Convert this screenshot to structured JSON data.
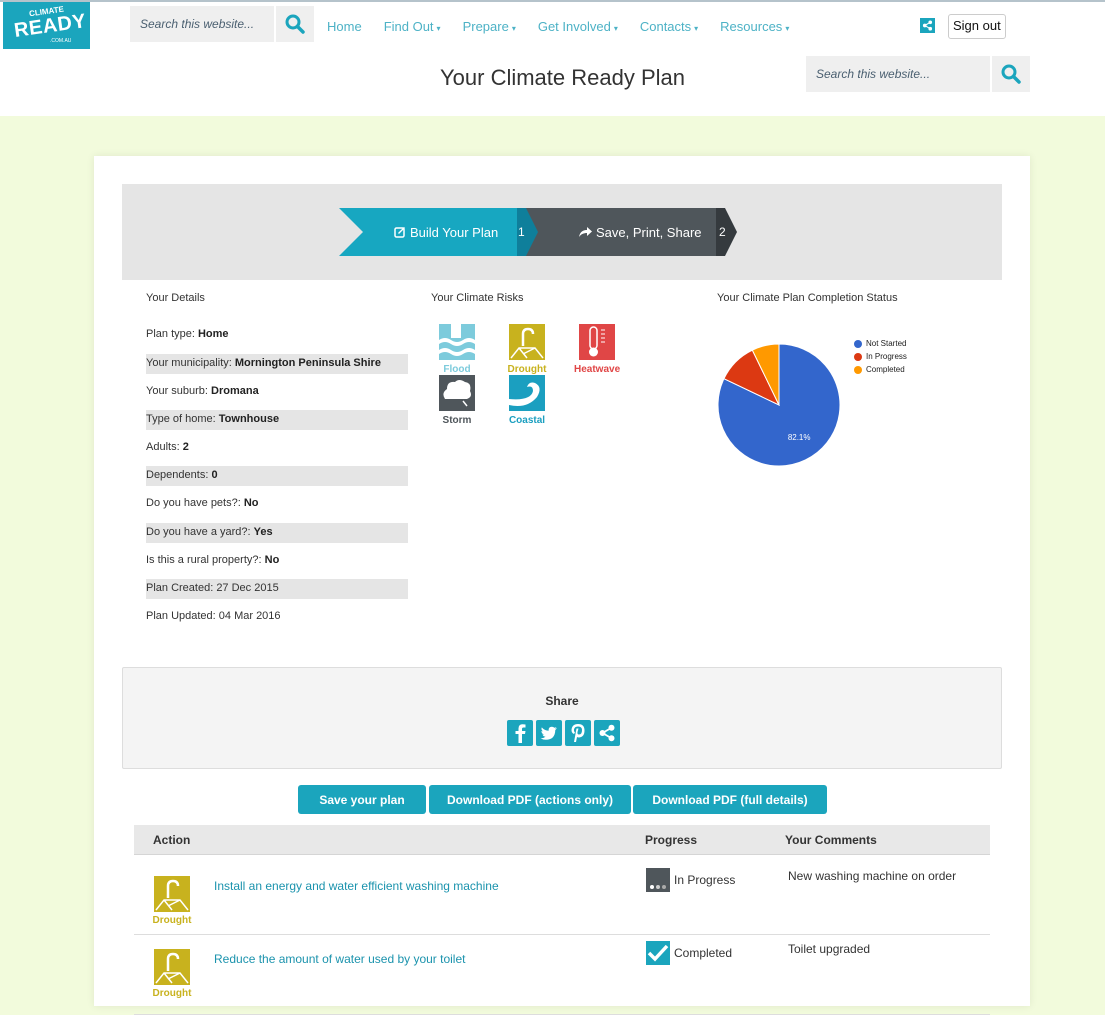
{
  "header": {
    "logo": {
      "line1": "CLIMATE",
      "line2": "READY",
      "line3": ".COM.AU"
    },
    "search_placeholder": "Search this website...",
    "nav": [
      {
        "label": "Home",
        "dropdown": false
      },
      {
        "label": "Find Out",
        "dropdown": true
      },
      {
        "label": "Prepare",
        "dropdown": true
      },
      {
        "label": "Get Involved",
        "dropdown": true
      },
      {
        "label": "Contacts",
        "dropdown": true
      },
      {
        "label": "Resources",
        "dropdown": true
      }
    ],
    "caret": "▾",
    "sign_out_label": "Sign out"
  },
  "title_bar": {
    "page_title": "Your Climate Ready Plan",
    "search_placeholder": "Search this website..."
  },
  "steps": [
    {
      "label": "Build Your Plan",
      "number": "1",
      "icon": "edit-icon",
      "active": true
    },
    {
      "label": "Save, Print, Share",
      "number": "2",
      "icon": "share-arrow-icon",
      "active": false
    }
  ],
  "details": {
    "heading": "Your Details",
    "rows": [
      {
        "label": "Plan type:",
        "value": "Home"
      },
      {
        "label": "Your municipality:",
        "value": "Mornington Peninsula Shire"
      },
      {
        "label": "Your suburb:",
        "value": "Dromana"
      },
      {
        "label": "Type of home:",
        "value": "Townhouse"
      },
      {
        "label": "Adults:",
        "value": "2"
      },
      {
        "label": "Dependents:",
        "value": "0"
      },
      {
        "label": "Do you have pets?:",
        "value": "No"
      },
      {
        "label": "Do you have a yard?:",
        "value": "Yes"
      },
      {
        "label": "Is this a rural property?:",
        "value": "No"
      },
      {
        "label": "Plan Created: 27 Dec 2015",
        "value": ""
      },
      {
        "label": "Plan Updated: 04 Mar 2016",
        "value": ""
      }
    ]
  },
  "risks": {
    "heading": "Your Climate Risks",
    "items": [
      {
        "label": "Flood",
        "color": "#7dcbdc"
      },
      {
        "label": "Drought",
        "color": "#c8b21e"
      },
      {
        "label": "Heatwave",
        "color": "#e04646"
      },
      {
        "label": "Storm",
        "color": "#4f565b"
      },
      {
        "label": "Coastal",
        "color": "#1b9fc0"
      }
    ]
  },
  "chart_data": {
    "type": "pie",
    "title": "Your Climate Plan Completion Status",
    "categories": [
      "Not Started",
      "In Progress",
      "Completed"
    ],
    "values": [
      82.1,
      10.7,
      7.2
    ],
    "colors": [
      "#3366cc",
      "#dc3912",
      "#ff9900"
    ],
    "data_labels": [
      "82.1%",
      "",
      ""
    ],
    "legend": "right"
  },
  "share": {
    "heading": "Share",
    "buttons": [
      "facebook",
      "twitter",
      "pinterest",
      "share"
    ]
  },
  "actions_bar": {
    "save_label": "Save your plan",
    "pdf_actions_label": "Download PDF (actions only)",
    "pdf_full_label": "Download PDF (full details)"
  },
  "table": {
    "headers": {
      "action": "Action",
      "progress": "Progress",
      "comments": "Your Comments"
    },
    "rows": [
      {
        "risk": "Drought",
        "action": "Install an energy and water efficient washing machine",
        "progress": "In Progress",
        "comment": "New washing machine on order"
      },
      {
        "risk": "Drought",
        "action": "Reduce the amount of water used by your toilet",
        "progress": "Completed",
        "comment": "Toilet upgraded"
      }
    ]
  }
}
